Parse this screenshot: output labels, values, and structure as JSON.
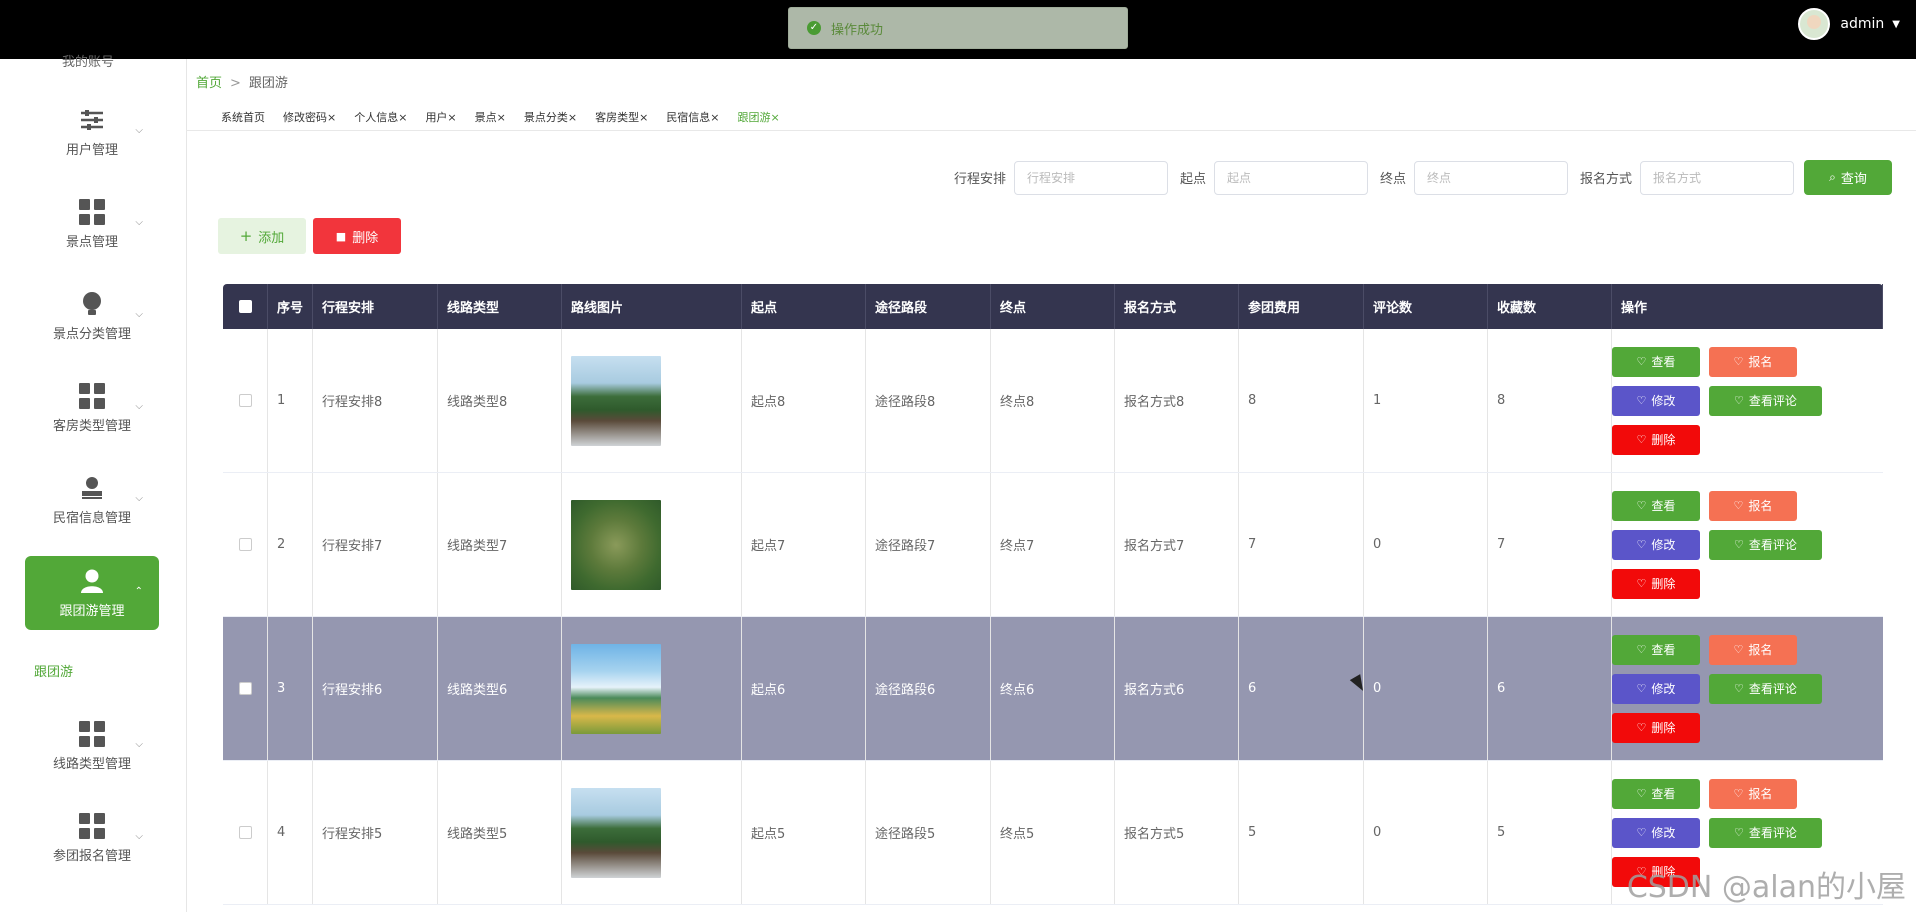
{
  "toast": {
    "message": "操作成功"
  },
  "user": {
    "name": "admin"
  },
  "sidebar": {
    "cut_label": "我的账号",
    "items": [
      {
        "label": "用户管理"
      },
      {
        "label": "景点管理"
      },
      {
        "label": "景点分类管理"
      },
      {
        "label": "客房类型管理"
      },
      {
        "label": "民宿信息管理"
      },
      {
        "label": "跟团游管理"
      },
      {
        "label": "线路类型管理"
      },
      {
        "label": "参团报名管理"
      }
    ],
    "sub_item": "跟团游"
  },
  "breadcrumb": {
    "home": "首页",
    "separator": ">",
    "current": "跟团游"
  },
  "tabs": [
    "系统首页",
    "修改密码×",
    "个人信息×",
    "用户×",
    "景点×",
    "景点分类×",
    "客房类型×",
    "民宿信息×",
    "跟团游×"
  ],
  "search": {
    "fields": [
      {
        "label": "行程安排",
        "placeholder": "行程安排"
      },
      {
        "label": "起点",
        "placeholder": "起点"
      },
      {
        "label": "终点",
        "placeholder": "终点"
      },
      {
        "label": "报名方式",
        "placeholder": "报名方式"
      }
    ],
    "button": "查询"
  },
  "actions": {
    "add": "添加",
    "delete": "删除"
  },
  "table": {
    "columns": [
      "序号",
      "行程安排",
      "线路类型",
      "路线图片",
      "起点",
      "途径路段",
      "终点",
      "报名方式",
      "参团费用",
      "评论数",
      "收藏数",
      "操作"
    ],
    "rows": [
      {
        "id": "1",
        "plan": "行程安排8",
        "route_type": "线路类型8",
        "start": "起点8",
        "via": "途径路段8",
        "end": "终点8",
        "signup": "报名方式8",
        "fee": "8",
        "comments": "1",
        "favorites": "8"
      },
      {
        "id": "2",
        "plan": "行程安排7",
        "route_type": "线路类型7",
        "start": "起点7",
        "via": "途径路段7",
        "end": "终点7",
        "signup": "报名方式7",
        "fee": "7",
        "comments": "0",
        "favorites": "7"
      },
      {
        "id": "3",
        "plan": "行程安排6",
        "route_type": "线路类型6",
        "start": "起点6",
        "via": "途径路段6",
        "end": "终点6",
        "signup": "报名方式6",
        "fee": "6",
        "comments": "0",
        "favorites": "6"
      },
      {
        "id": "4",
        "plan": "行程安排5",
        "route_type": "线路类型5",
        "start": "起点5",
        "via": "途径路段5",
        "end": "终点5",
        "signup": "报名方式5",
        "fee": "5",
        "comments": "0",
        "favorites": "5"
      }
    ],
    "ops": {
      "view": "查看",
      "signup": "报名",
      "edit": "修改",
      "comments": "查看评论",
      "delete": "删除"
    }
  },
  "watermark": "CSDN @alan的小屋",
  "colors": {
    "primary": "#52a838",
    "header": "#34354f",
    "highlight_row": "#9597b0",
    "danger": "#f20a0a",
    "orange": "#f57153",
    "purple": "#5b55c9"
  }
}
